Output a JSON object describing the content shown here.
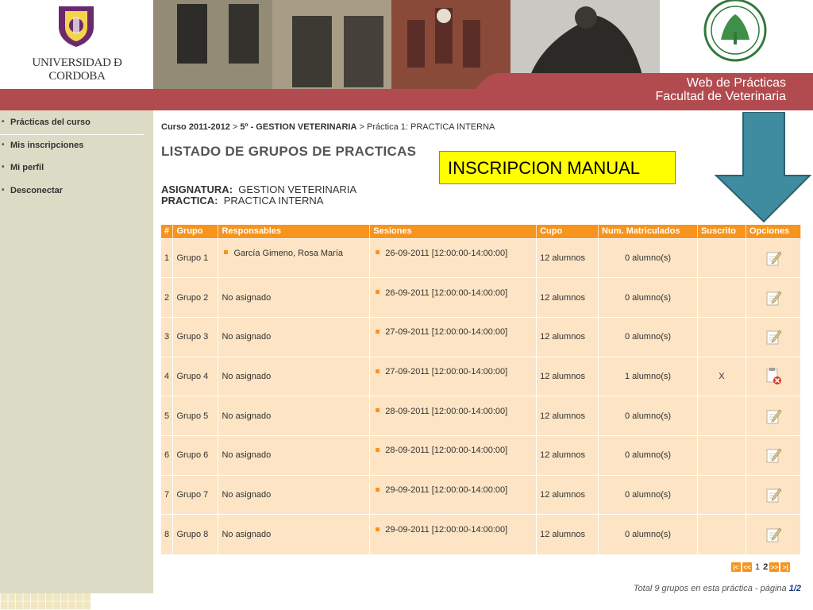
{
  "header": {
    "university_name": "UNIVERSIDAD Ð CORDOBA",
    "site_title_line1": "Web de Prácticas",
    "site_title_line2": "Facultad de Veterinaria",
    "banner_color": "#b24b4f",
    "logo_icon": "university-crest-icon",
    "seal_icon": "veterinary-faculty-seal-icon"
  },
  "sidebar": {
    "items": [
      {
        "label": "Prácticas del curso"
      },
      {
        "label": "Mis inscripciones"
      },
      {
        "label": "Mi perfil"
      },
      {
        "label": "Desconectar"
      }
    ]
  },
  "breadcrumb": {
    "course": "Curso 2011-2012",
    "sep1": " > ",
    "subject": "5º - GESTION VETERINARIA",
    "sep2": " > ",
    "practice": "Práctica 1: PRACTICA INTERNA"
  },
  "page_title": "LISTADO DE GRUPOS DE PRACTICAS",
  "annotation": {
    "label": "INSCRIPCION MANUAL",
    "color": "#ffff00",
    "arrow_color": "#3f8b9f"
  },
  "meta": {
    "subject_key": "ASIGNATURA:",
    "subject_value": "GESTION VETERINARIA",
    "practice_key": "PRACTICA:",
    "practice_value": "PRACTICA INTERNA"
  },
  "table": {
    "headers": [
      "#",
      "Grupo",
      "Responsables",
      "Sesiones",
      "Cupo",
      "Num. Matriculados",
      "Suscrito",
      "Opciones"
    ],
    "header_color": "#f7941d",
    "row_color": "#fce4c4",
    "rows": [
      {
        "num": "1",
        "group": "Grupo 1",
        "resp": "García Gimeno, Rosa María",
        "resp_bullet": true,
        "session": "26-09-2011 [12:00:00-14:00:00]",
        "cupo": "12 alumnos",
        "matric": "0 alumno(s)",
        "suscrito": "",
        "option_icon": "edit-note-icon"
      },
      {
        "num": "2",
        "group": "Grupo 2",
        "resp": "No asignado",
        "resp_bullet": false,
        "session": "26-09-2011 [12:00:00-14:00:00]",
        "cupo": "12 alumnos",
        "matric": "0 alumno(s)",
        "suscrito": "",
        "option_icon": "edit-note-icon"
      },
      {
        "num": "3",
        "group": "Grupo 3",
        "resp": "No asignado",
        "resp_bullet": false,
        "session": "27-09-2011 [12:00:00-14:00:00]",
        "cupo": "12 alumnos",
        "matric": "0 alumno(s)",
        "suscrito": "",
        "option_icon": "edit-note-icon"
      },
      {
        "num": "4",
        "group": "Grupo 4",
        "resp": "No asignado",
        "resp_bullet": false,
        "session": "27-09-2011 [12:00:00-14:00:00]",
        "cupo": "12 alumnos",
        "matric": "1 alumno(s)",
        "suscrito": "X",
        "option_icon": "unsubscribe-icon"
      },
      {
        "num": "5",
        "group": "Grupo 5",
        "resp": "No asignado",
        "resp_bullet": false,
        "session": "28-09-2011 [12:00:00-14:00:00]",
        "cupo": "12 alumnos",
        "matric": "0 alumno(s)",
        "suscrito": "",
        "option_icon": "edit-note-icon"
      },
      {
        "num": "6",
        "group": "Grupo 6",
        "resp": "No asignado",
        "resp_bullet": false,
        "session": "28-09-2011 [12:00:00-14:00:00]",
        "cupo": "12 alumnos",
        "matric": "0 alumno(s)",
        "suscrito": "",
        "option_icon": "edit-note-icon"
      },
      {
        "num": "7",
        "group": "Grupo 7",
        "resp": "No asignado",
        "resp_bullet": false,
        "session": "29-09-2011 [12:00:00-14:00:00]",
        "cupo": "12 alumnos",
        "matric": "0 alumno(s)",
        "suscrito": "",
        "option_icon": "edit-note-icon"
      },
      {
        "num": "8",
        "group": "Grupo 8",
        "resp": "No asignado",
        "resp_bullet": false,
        "session": "29-09-2011 [12:00:00-14:00:00]",
        "cupo": "12 alumnos",
        "matric": "0 alumno(s)",
        "suscrito": "",
        "option_icon": "edit-note-icon"
      }
    ]
  },
  "pager": {
    "first_icon": "first-page-icon",
    "prev_icon": "prev-page-icon",
    "next_icon": "next-page-icon",
    "last_icon": "last-page-icon",
    "pages": [
      "1",
      "2"
    ],
    "current_page": "2",
    "total_text": "Total 9 grupos en esta práctica - página ",
    "page_of": "1/2"
  }
}
